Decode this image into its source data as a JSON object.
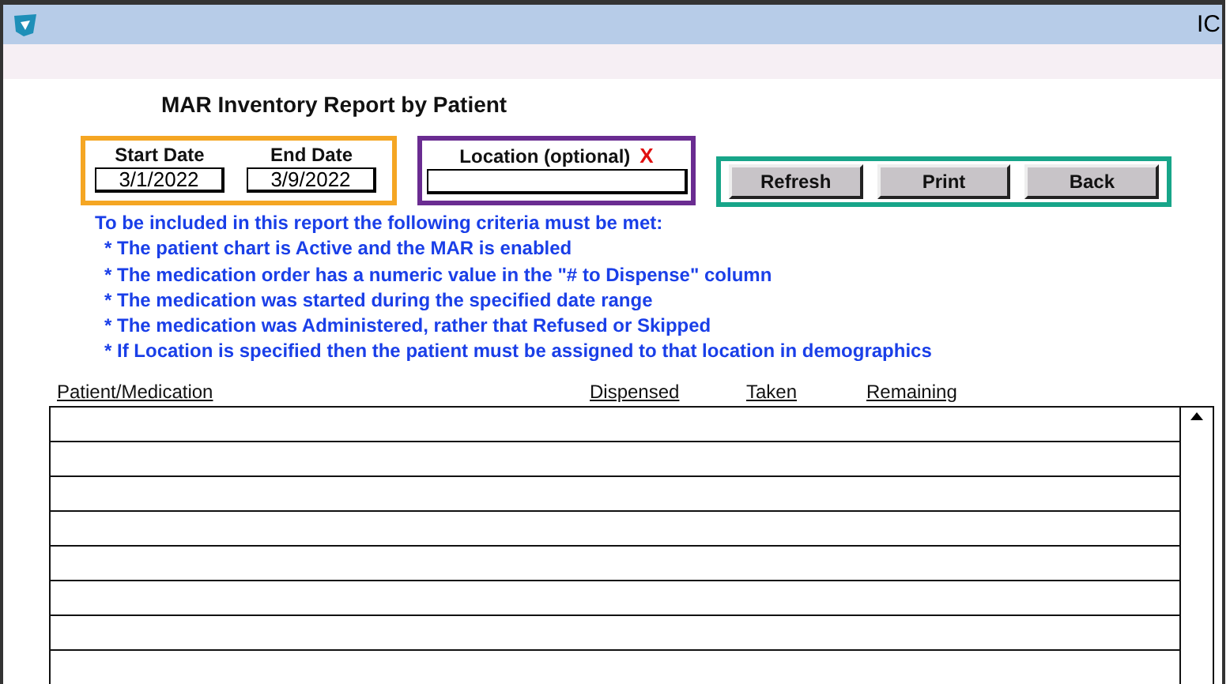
{
  "window": {
    "title": "IC"
  },
  "report": {
    "title": "MAR Inventory Report by Patient"
  },
  "dates": [
    {
      "label": "Start Date",
      "value": "3/1/2022"
    },
    {
      "label": "End Date",
      "value": "3/9/2022"
    }
  ],
  "location": {
    "label": "Location (optional)",
    "clear": "X"
  },
  "buttons": [
    "Refresh",
    "Print",
    "Back"
  ],
  "criteria": {
    "intro": "To be included in this report the following criteria must be met:",
    "items": [
      "* The patient chart is Active and the MAR is enabled",
      "* The medication order has a numeric value in the \"# to Dispense\" column",
      "* The medication was started during the specified date range",
      "* The medication was Administered, rather that Refused or Skipped",
      "* If Location is specified then the patient must be assigned to that location in demographics"
    ]
  },
  "table": {
    "columns": [
      "Patient/Medication",
      "Dispensed",
      "Taken",
      "Remaining"
    ]
  }
}
